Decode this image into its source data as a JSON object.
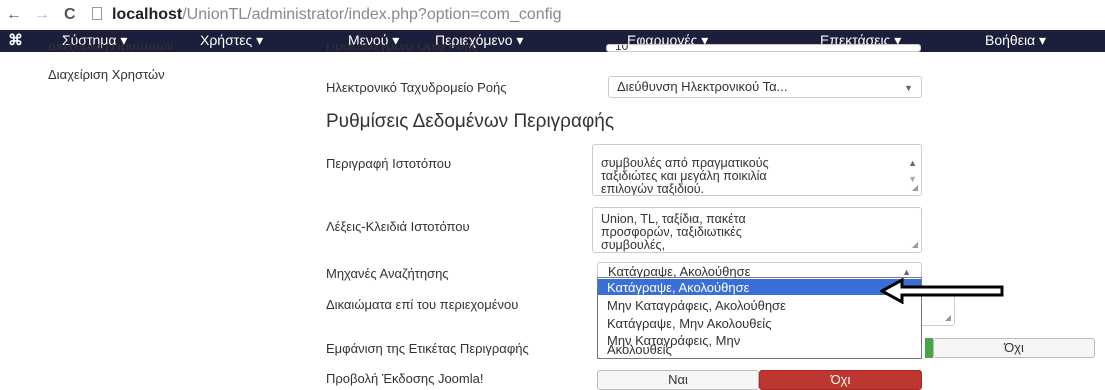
{
  "browser": {
    "back": "←",
    "forward": "→",
    "reload": "C",
    "url_host": "localhost",
    "url_path": "/UnionTL/administrator/index.php?option=com_config"
  },
  "navbar": {
    "logo": "⌘",
    "items": [
      "Σύστημα ▾",
      "Χρήστες ▾",
      "Μενού ▾",
      "Περιεχόμενο ▾",
      "Εφαρμογές ▾",
      "Επεκτάσεις ▾",
      "Βοήθεια ▾"
    ]
  },
  "sidebar": {
    "items": [
      "Διαχείριση Προτύπων",
      "Διαχείριση Χρηστών"
    ]
  },
  "form": {
    "default_limit_label": "Προεπιλεγμένο Όριο Ροής",
    "default_limit_value": "10",
    "feed_email_label": "Ηλεκτρονικό Ταχυδρομείο Ροής",
    "feed_email_value": "Διεύθυνση Ηλεκτρονικού Τα...",
    "metadata_heading": "Ρυθμίσεις Δεδομένων Περιγραφής",
    "site_desc_label": "Περιγραφή Ιστοτόπου",
    "site_desc_lines": [
      "συμβουλές από πραγματικούς",
      "ταξιδιώτες και μεγάλη ποικιλία",
      "επιλογών ταξιδιού."
    ],
    "site_keywords_label": "Λέξεις-Κλειδιά Ιστοτόπου",
    "site_keywords_lines": [
      "Union, TL, ταξίδια, πακέτα",
      "προσφορών, ταξιδιωτικές",
      "συμβουλές,"
    ],
    "robots_label": "Μηχανές Αναζήτησης",
    "robots_value": "Κατάγραψε, Ακολούθησε",
    "robots_options": [
      "Κατάγραψε, Ακολούθησε",
      "Μην Καταγράφεις, Ακολούθησε",
      "Κατάγραψε, Μην Ακολουθείς",
      "Μην Καταγράφεις, Μην",
      "Ακολουθείς"
    ],
    "content_rights_label": "Δικαιώματα επί του περιεχομένου",
    "show_author_label": "Εμφάνιση της Ετικέτας Περιγραφής",
    "show_author_no": "Όχι",
    "show_version_label": "Προβολή Έκδοσης Joomla!",
    "show_version_yes": "Ναι",
    "show_version_no": "Όχι"
  },
  "colors": {
    "navbar": "#1b1f3b",
    "selected_option": "#3a6fd8",
    "no_active": "#bd362f",
    "yes_active": "#46a546"
  }
}
